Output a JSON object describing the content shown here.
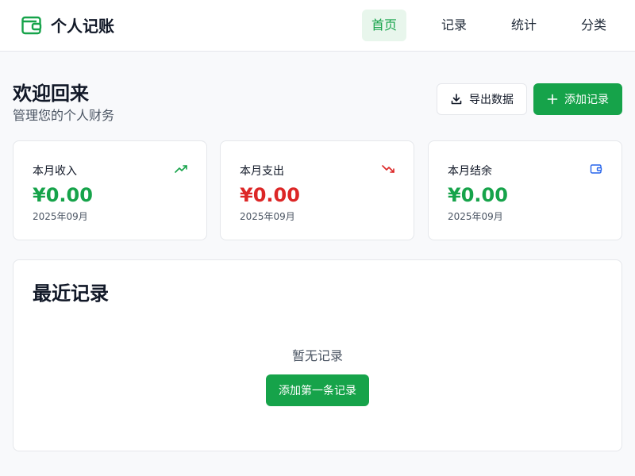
{
  "app": {
    "title": "个人记账"
  },
  "nav": [
    {
      "label": "首页",
      "active": true
    },
    {
      "label": "记录",
      "active": false
    },
    {
      "label": "统计",
      "active": false
    },
    {
      "label": "分类",
      "active": false
    }
  ],
  "header": {
    "title": "欢迎回来",
    "subtitle": "管理您的个人财务",
    "export_label": "导出数据",
    "add_label": "添加记录"
  },
  "cards": [
    {
      "label": "本月收入",
      "value": "¥0.00",
      "date": "2025年09月",
      "color": "#16a34a",
      "icon": "trending-up-icon"
    },
    {
      "label": "本月支出",
      "value": "¥0.00",
      "date": "2025年09月",
      "color": "#dc2626",
      "icon": "trending-down-icon"
    },
    {
      "label": "本月结余",
      "value": "¥0.00",
      "date": "2025年09月",
      "color": "#16a34a",
      "icon": "wallet-icon"
    }
  ],
  "recent": {
    "title": "最近记录",
    "empty_text": "暂无记录",
    "add_first_label": "添加第一条记录"
  },
  "colors": {
    "accent": "#16a34a",
    "danger": "#dc2626",
    "info": "#2563eb"
  }
}
